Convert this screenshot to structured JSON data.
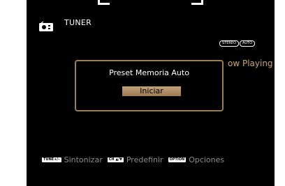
{
  "source": {
    "icon": "radio-icon",
    "title": "TUNER"
  },
  "indicators": [
    "STEREO",
    "AUTO"
  ],
  "now_playing": "ow Playing",
  "dialog": {
    "title": "Preset Memoria Auto",
    "button_label": "Iniciar"
  },
  "footer": {
    "items": [
      {
        "key": "TUNE+/–",
        "label": "Sintonizar"
      },
      {
        "key": "CH ▲/▼",
        "label": "Predefinir"
      },
      {
        "key": "OPTION",
        "label": "Opciones"
      }
    ]
  },
  "colors": {
    "background": "#000000",
    "accent": "#c9a66b",
    "dialog_border": "#9a7e58",
    "button": "#b3926b",
    "text": "#ffffff",
    "footer_text": "#8c8c8c"
  }
}
